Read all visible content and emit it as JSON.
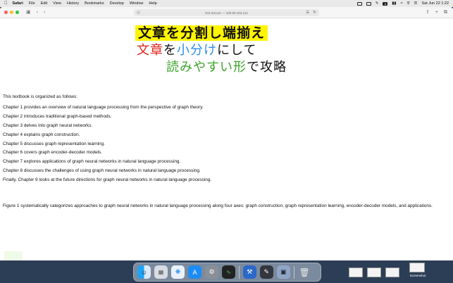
{
  "menubar": {
    "app": "Safari",
    "items": [
      "File",
      "Edit",
      "View",
      "History",
      "Bookmarks",
      "Develop",
      "Window",
      "Help"
    ],
    "status_a": "A",
    "datetime": "Sat Jun 22  1:22"
  },
  "browser": {
    "address": "Not Secure — 100.90.104.114"
  },
  "banner": {
    "line1": "文章を分割し端揃え",
    "line2": [
      {
        "text": "文章",
        "color": "#e0241a"
      },
      {
        "text": "を",
        "color": "#111111"
      },
      {
        "text": "小分け",
        "color": "#2c8ee6"
      },
      {
        "text": "にして",
        "color": "#111111"
      }
    ],
    "line3": [
      {
        "text": "読みやすい形",
        "color": "#3ea52c"
      },
      {
        "text": "で攻略",
        "color": "#111111"
      }
    ]
  },
  "content": {
    "intro": "This textbook is organized as follows:",
    "chapters": [
      "Chapter 1 provides an overview of natural language processing from the perspective of graph theory.",
      "Chapter 2 introduces traditional graph-based methods.",
      "Chapter 3 delves into graph neural networks.",
      "Chapter 4 explains graph construction.",
      "Chapter 5 discusses graph representation learning.",
      "Chapter 6 covers graph encoder-decoder models.",
      "Chapter 7 explores applications of graph neural networks in natural language processing.",
      "Chapter 8 discusses the challenges of using graph neural networks in natural language processing.",
      "Finally, Chapter 9 looks at the future directions for graph neural networks in natural language processing."
    ],
    "figure": "Figure 1 systematically categorizes approaches to graph neural networks in natural language processing along four axes: graph construction, graph representation learning, encoder-decoder models, and applications."
  },
  "dock": {
    "screenshot_label": "Screenshot"
  }
}
